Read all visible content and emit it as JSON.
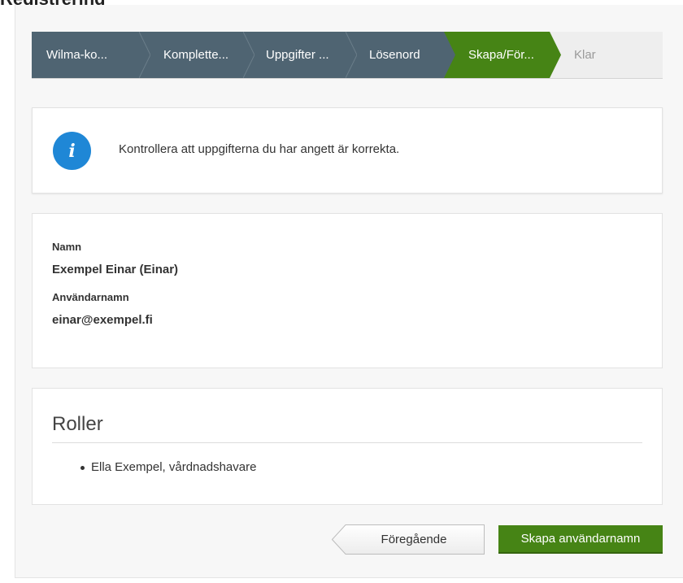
{
  "page": {
    "title": "Registrering"
  },
  "stepper": {
    "steps": [
      {
        "label": "Wilma-ko...",
        "state": "done"
      },
      {
        "label": "Komplette...",
        "state": "done"
      },
      {
        "label": "Uppgifter ...",
        "state": "done"
      },
      {
        "label": "Lösenord",
        "state": "done"
      },
      {
        "label": "Skapa/För...",
        "state": "active"
      },
      {
        "label": "Klar",
        "state": "todo"
      }
    ],
    "colors": {
      "done": "#4f6472",
      "active": "#468415",
      "todo": "#eeeeee"
    }
  },
  "info": {
    "icon": "info-icon",
    "glyph": "i",
    "message": "Kontrollera att uppgifterna du har angett är korrekta."
  },
  "details": {
    "name_label": "Namn",
    "name_value": "Exempel Einar (Einar)",
    "username_label": "Användarnamn",
    "username_value": "einar@exempel.fi"
  },
  "roles": {
    "title": "Roller",
    "items": [
      "Ella Exempel, vårdnadshavare"
    ]
  },
  "actions": {
    "previous_label": "Föregående",
    "create_label": "Skapa användarnamn"
  }
}
